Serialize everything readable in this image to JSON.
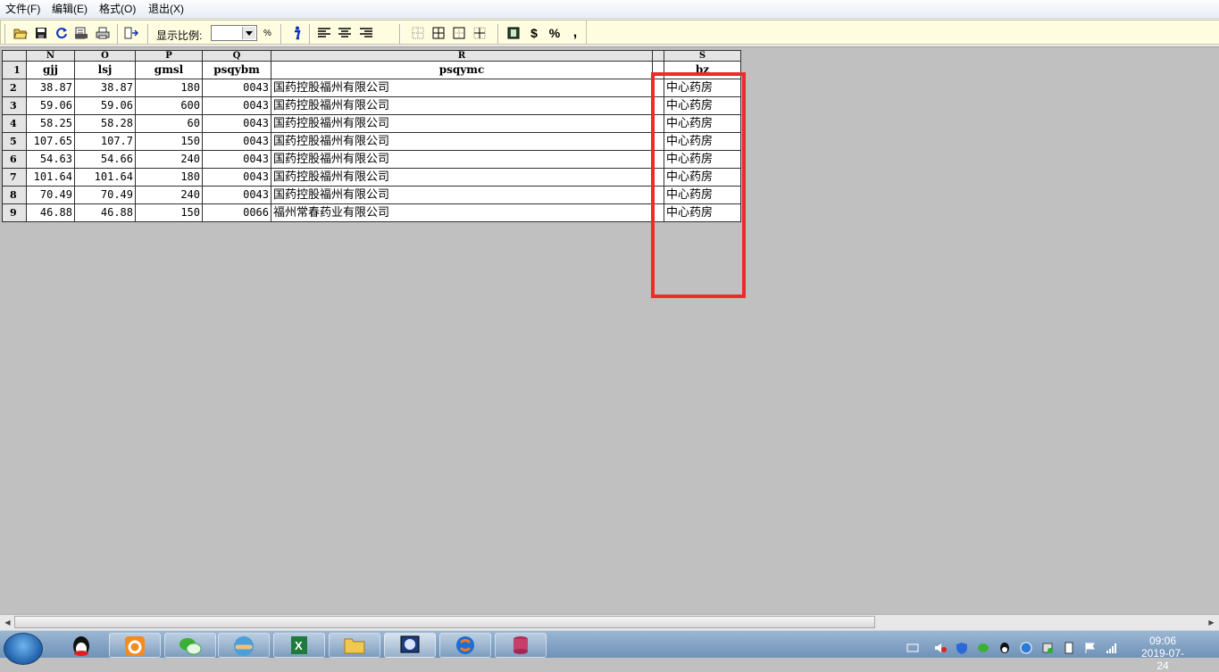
{
  "menu": [
    "文件(F)",
    "编辑(E)",
    "格式(O)",
    "退出(X)"
  ],
  "toolbar": {
    "zoom_label": "显示比例:",
    "zoom_value": "",
    "percent": "%",
    "icons": [
      "open-icon",
      "save-icon",
      "refresh-icon",
      "preview-icon",
      "print-icon",
      "export-icon",
      "info-icon",
      "align-left-icon",
      "align-center-icon",
      "align-right-icon",
      "border-none-icon",
      "border-all-icon",
      "border-outer-icon",
      "border-inner-icon",
      "currency-format-icon",
      "dollar-icon",
      "percent-icon",
      "comma-icon"
    ]
  },
  "sheet": {
    "columns": [
      "N",
      "O",
      "P",
      "Q",
      "R",
      "S"
    ],
    "fields": [
      "gjj",
      "lsj",
      "gmsl",
      "psqybm",
      "psqymc",
      "bz"
    ],
    "rows": [
      {
        "n": "2",
        "gjj": "38.87",
        "lsj": "38.87",
        "gmsl": "180",
        "psqybm": "0043",
        "psqymc": "国药控股福州有限公司",
        "bz": "中心药房"
      },
      {
        "n": "3",
        "gjj": "59.06",
        "lsj": "59.06",
        "gmsl": "600",
        "psqybm": "0043",
        "psqymc": "国药控股福州有限公司",
        "bz": "中心药房"
      },
      {
        "n": "4",
        "gjj": "58.25",
        "lsj": "58.28",
        "gmsl": "60",
        "psqybm": "0043",
        "psqymc": "国药控股福州有限公司",
        "bz": "中心药房"
      },
      {
        "n": "5",
        "gjj": "107.65",
        "lsj": "107.7",
        "gmsl": "150",
        "psqybm": "0043",
        "psqymc": "国药控股福州有限公司",
        "bz": "中心药房"
      },
      {
        "n": "6",
        "gjj": "54.63",
        "lsj": "54.66",
        "gmsl": "240",
        "psqybm": "0043",
        "psqymc": "国药控股福州有限公司",
        "bz": "中心药房"
      },
      {
        "n": "7",
        "gjj": "101.64",
        "lsj": "101.64",
        "gmsl": "180",
        "psqybm": "0043",
        "psqymc": "国药控股福州有限公司",
        "bz": "中心药房"
      },
      {
        "n": "8",
        "gjj": "70.49",
        "lsj": "70.49",
        "gmsl": "240",
        "psqybm": "0043",
        "psqymc": "国药控股福州有限公司",
        "bz": "中心药房"
      },
      {
        "n": "9",
        "gjj": "46.88",
        "lsj": "46.88",
        "gmsl": "150",
        "psqybm": "0066",
        "psqymc": "福州常春药业有限公司",
        "bz": "中心药房"
      }
    ],
    "header_row_number": "1"
  },
  "taskbar": {
    "apps": [
      "qq-icon",
      "uc-browser-icon",
      "wechat-icon",
      "handshake-app-icon",
      "excel-icon",
      "folder-icon",
      "sql-tool-icon",
      "sogou-icon",
      "database-icon"
    ],
    "clock_time": "09:06",
    "clock_date": "2019-07-24"
  },
  "colors": {
    "highlight_box": "#ee2b2b",
    "toolbar_bg": "#fffde0",
    "sheet_bg": "#c0c0c0"
  }
}
